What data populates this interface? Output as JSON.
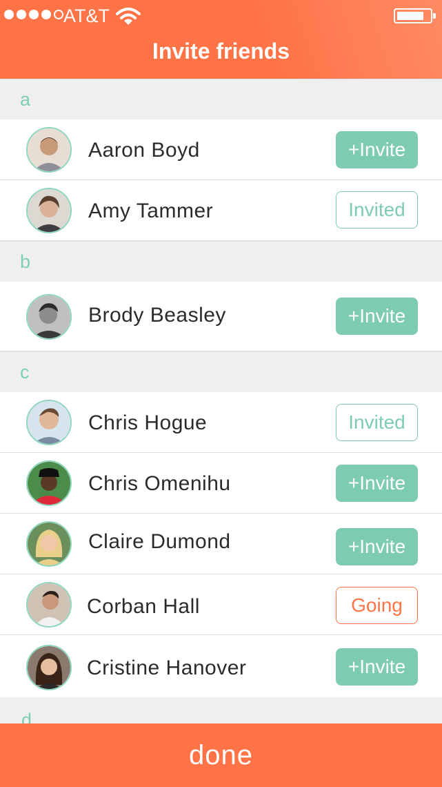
{
  "status_bar": {
    "carrier": "AT&T",
    "signal_icon": "signal-dots-icon",
    "wifi_icon": "wifi-icon",
    "battery_icon": "battery-icon"
  },
  "header": {
    "title": "Invite friends"
  },
  "colors": {
    "accent": "#ff7346",
    "mint": "#7dccb1",
    "section_bg": "#efefef"
  },
  "sections": [
    {
      "letter": "a",
      "contacts": [
        {
          "name": "Aaron Boyd",
          "status_label": "+Invite",
          "status": "invite"
        },
        {
          "name": "Amy Tammer",
          "status_label": "Invited",
          "status": "invited"
        }
      ]
    },
    {
      "letter": "b",
      "contacts": [
        {
          "name": "Brody Beasley",
          "status_label": "+Invite",
          "status": "invite"
        }
      ]
    },
    {
      "letter": "c",
      "contacts": [
        {
          "name": "Chris Hogue",
          "status_label": "Invited",
          "status": "invited"
        },
        {
          "name": "Chris Omenihu",
          "status_label": "+Invite",
          "status": "invite"
        },
        {
          "name": "Claire Dumond",
          "status_label": "+Invite",
          "status": "invite"
        },
        {
          "name": "Corban Hall",
          "status_label": "Going",
          "status": "going"
        },
        {
          "name": "Cristine Hanover",
          "status_label": "+Invite",
          "status": "invite"
        }
      ]
    },
    {
      "letter": "d",
      "contacts": []
    }
  ],
  "footer": {
    "done_label": "done"
  }
}
